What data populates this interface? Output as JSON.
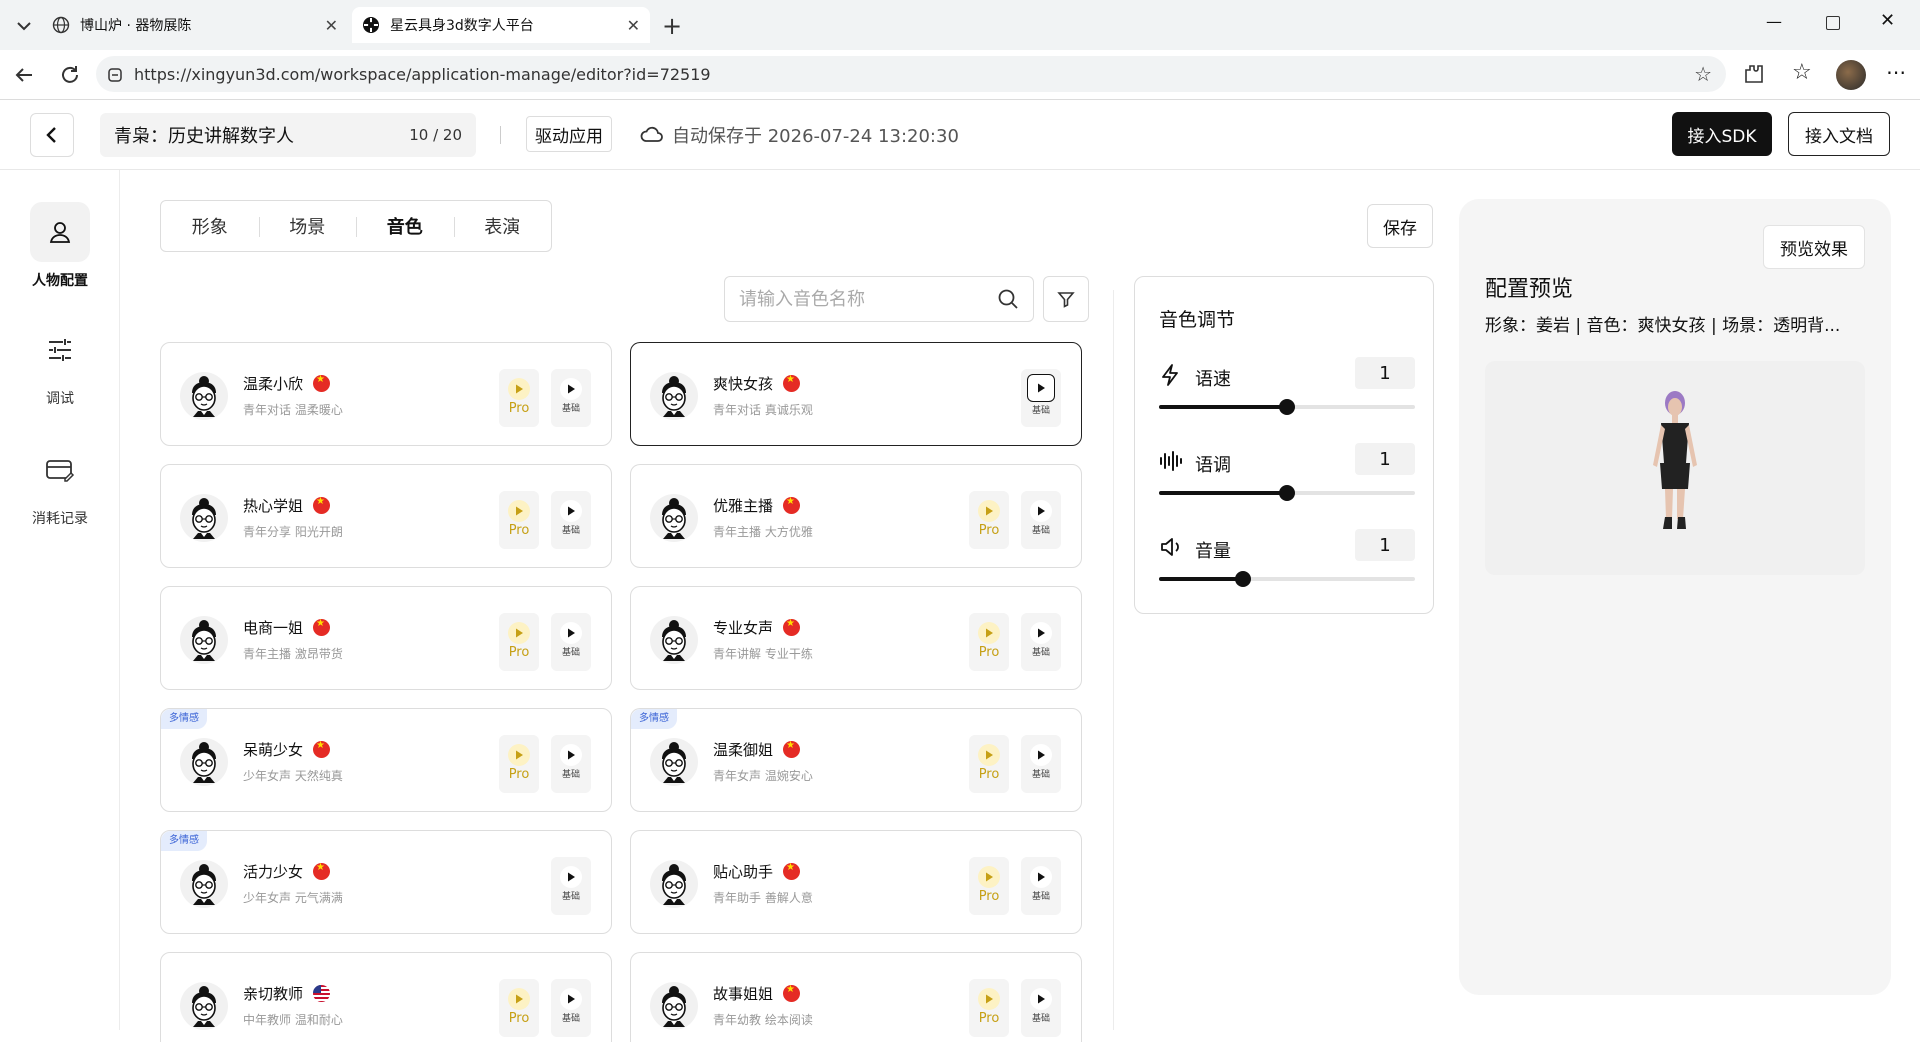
{
  "browser": {
    "tabs": [
      {
        "title": "博山炉 · 器物展陈"
      },
      {
        "title": "星云具身3d数字人平台"
      }
    ],
    "url": "https://xingyun3d.com/workspace/application-manage/editor?id=72519"
  },
  "header": {
    "app_name": "青枭：历史讲解数字人",
    "name_count": "10 / 20",
    "drive_label": "驱动应用",
    "autosave": "自动保存于 2026-07-24 13:20:30",
    "sdk_label": "接入SDK",
    "docs_label": "接入文档"
  },
  "sidebar": {
    "items": [
      {
        "label": "人物配置",
        "icon": "person-icon"
      },
      {
        "label": "调试",
        "icon": "sliders-icon"
      },
      {
        "label": "消耗记录",
        "icon": "card-icon"
      }
    ]
  },
  "config_tabs": [
    "形象",
    "场景",
    "音色",
    "表演"
  ],
  "active_tab": "音色",
  "save_label": "保存",
  "search": {
    "placeholder": "请输入音色名称"
  },
  "voices": [
    {
      "name": "温柔小欣",
      "desc": "青年对话 温柔暖心",
      "flag": "cn",
      "pro": true,
      "basic": "基础",
      "badge": "",
      "selected": false
    },
    {
      "name": "爽快女孩",
      "desc": "青年对话 真诚乐观",
      "flag": "cn",
      "pro": false,
      "basic": "基础",
      "badge": "",
      "selected": true
    },
    {
      "name": "热心学姐",
      "desc": "青年分享 阳光开朗",
      "flag": "cn",
      "pro": true,
      "basic": "基础",
      "badge": "",
      "selected": false
    },
    {
      "name": "优雅主播",
      "desc": "青年主播 大方优雅",
      "flag": "cn",
      "pro": true,
      "basic": "基础",
      "badge": "",
      "selected": false
    },
    {
      "name": "电商一姐",
      "desc": "青年主播 激昂带货",
      "flag": "cn",
      "pro": true,
      "basic": "基础",
      "badge": "",
      "selected": false
    },
    {
      "name": "专业女声",
      "desc": "青年讲解 专业干练",
      "flag": "cn",
      "pro": true,
      "basic": "基础",
      "badge": "",
      "selected": false
    },
    {
      "name": "呆萌少女",
      "desc": "少年女声 天然纯真",
      "flag": "cn",
      "pro": true,
      "basic": "基础",
      "badge": "多情感",
      "selected": false
    },
    {
      "name": "温柔御姐",
      "desc": "青年女声 温婉安心",
      "flag": "cn",
      "pro": true,
      "basic": "基础",
      "badge": "多情感",
      "selected": false
    },
    {
      "name": "活力少女",
      "desc": "少年女声 元气满满",
      "flag": "cn",
      "pro": false,
      "basic": "基础",
      "badge": "多情感",
      "selected": false
    },
    {
      "name": "贴心助手",
      "desc": "青年助手 善解人意",
      "flag": "cn",
      "pro": true,
      "basic": "基础",
      "badge": "",
      "selected": false
    },
    {
      "name": "亲切教师",
      "desc": "中年教师 温和耐心",
      "flag": "us",
      "pro": true,
      "basic": "基础",
      "badge": "",
      "selected": false
    },
    {
      "name": "故事姐姐",
      "desc": "青年幼教 绘本阅读",
      "flag": "cn",
      "pro": true,
      "basic": "基础",
      "badge": "",
      "selected": false
    }
  ],
  "pro_label": "Pro",
  "adjust": {
    "title": "音色调节",
    "rows": [
      {
        "label": "语速",
        "value": "1",
        "level": 0.5,
        "icon": "lightning-icon"
      },
      {
        "label": "语调",
        "value": "1",
        "level": 0.5,
        "icon": "waveform-icon"
      },
      {
        "label": "音量",
        "value": "1",
        "level": 0.33,
        "icon": "speaker-icon"
      }
    ]
  },
  "preview": {
    "button": "预览效果",
    "title": "配置预览",
    "summary": "形象：姜岩 | 音色：爽快女孩 | 场景：透明背..."
  }
}
